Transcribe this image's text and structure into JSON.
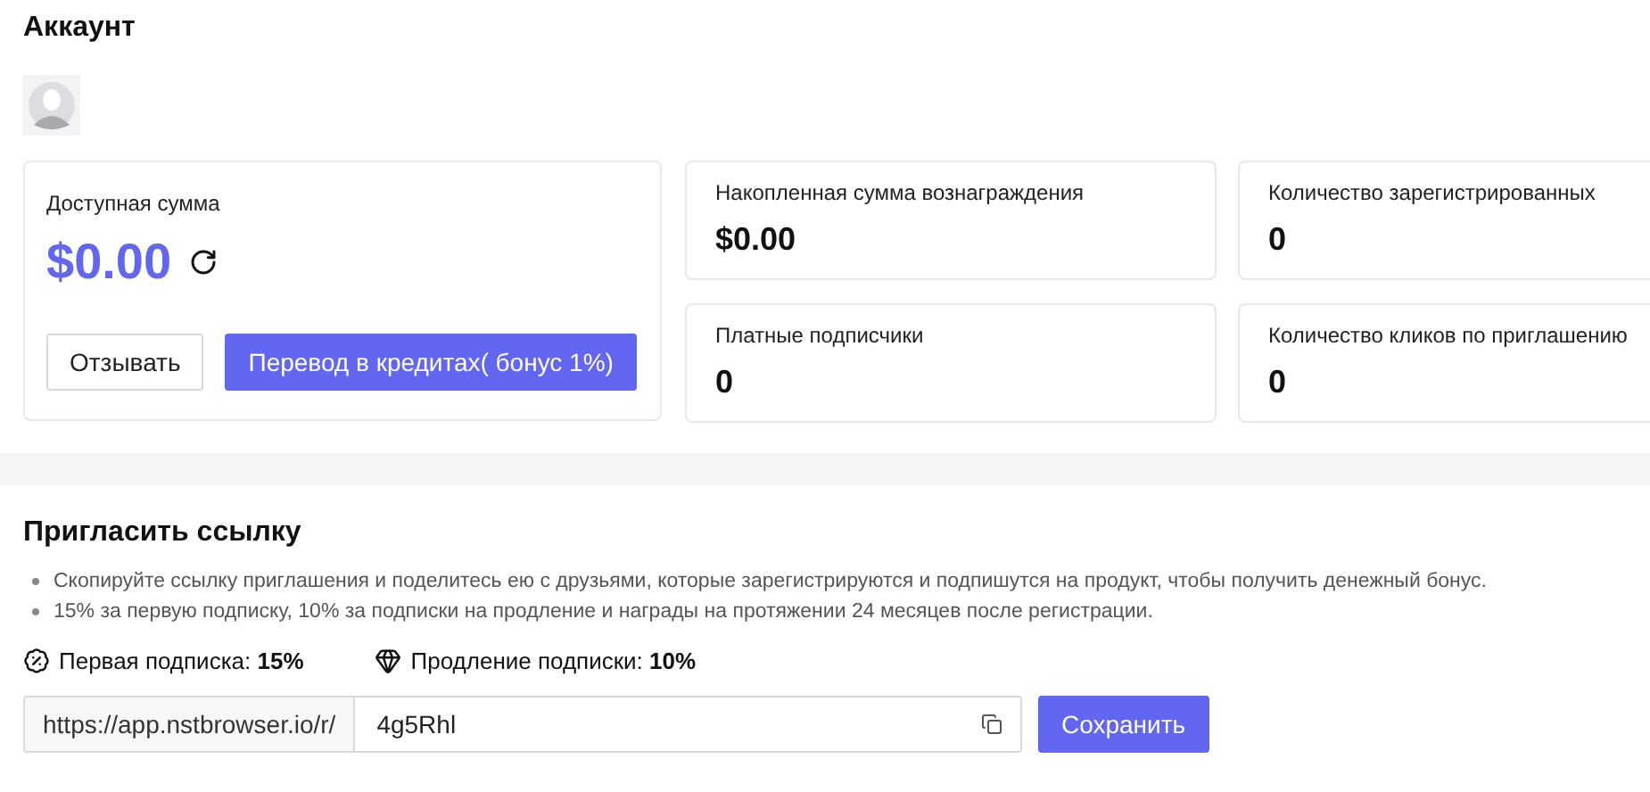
{
  "account": {
    "title": "Аккаунт",
    "balance": {
      "label": "Доступная сумма",
      "amount": "$0.00",
      "buttons": [
        {
          "label": "Отзывать",
          "kind": "outline"
        },
        {
          "label": "Перевод в кредитах( бонус 1%)",
          "kind": "primary"
        }
      ]
    },
    "stats": [
      {
        "label": "Накопленная сумма вознаграждения",
        "value": "$0.00"
      },
      {
        "label": "Количество зарегистрированных",
        "value": "0"
      },
      {
        "label": "Платные подписчики",
        "value": "0"
      },
      {
        "label": "Количество кликов по приглашению",
        "value": "0"
      }
    ]
  },
  "invite": {
    "title": "Пригласить ссылку",
    "notes": [
      "Скопируйте ссылку приглашения и поделитесь ею с друзьями, которые зарегистрируются и подпишутся на продукт, чтобы получить денежный бонус.",
      "15% за первую подписку, 10% за подписки на продление и награды на протяжении 24 месяцев после регистрации."
    ],
    "rates": [
      {
        "kind": "first",
        "text": "Первая подписка: **15%**"
      },
      {
        "kind": "renewal",
        "text": "Продление подписки: **10%**"
      }
    ],
    "link_prefix": "https://app.nstbrowser.io/r/",
    "code": "4g5Rhl",
    "save": "Сохранить"
  }
}
